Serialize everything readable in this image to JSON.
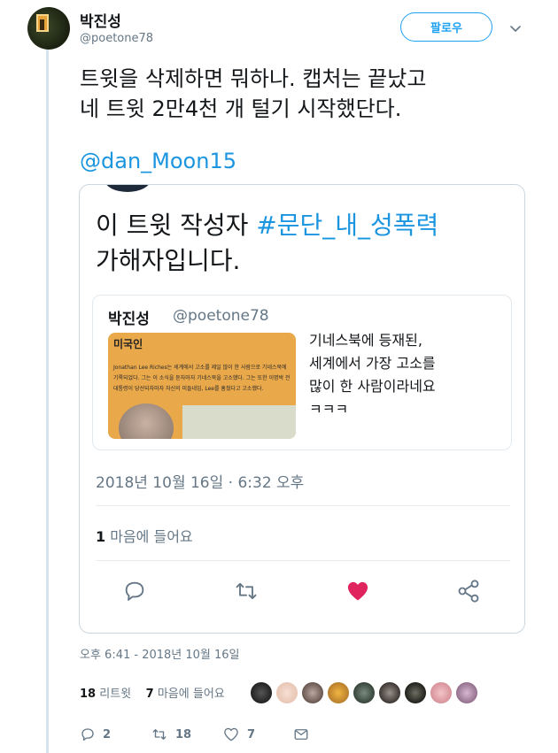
{
  "author": {
    "name": "박진성",
    "handle": "@poetone78"
  },
  "follow_button": "팔로우",
  "tweet": {
    "text_line1": "트윗을 삭제하면 뭐하나. 캡처는 끝났고",
    "text_line2": "네 트윗 2만4천 개 털기 시작했단다.",
    "mention": "@dan_Moon15"
  },
  "quoted_tweet": {
    "text_prefix": "이 트윗 작성자 ",
    "hashtag": "#문단_내_성폭력",
    "text_line2": "가해자입니다.",
    "timestamp": "2018년 10월 16일 · 6:32 오후",
    "likes_count": "1",
    "likes_label": "마음에 들어요",
    "inner": {
      "name": "박진성",
      "handle": "@poetone78",
      "thumb_title": "미국인",
      "thumb_body": "Jonathan Lee Riches는 세계에서 고소를 제일 많이 한 사람으로 기네스북에 기록되었다. 그는 이 소식을 듣자마자 기네스북을 고소했다. 그는 또한 이명박 전 대통령이 당선되자마자 자신의 미들네임, Lee를 훔쳤다고 고소했다.",
      "text_line1": "기네스북에 등재된,",
      "text_line2": "세계에서 가장 고소를",
      "text_line3": "많이 한 사람이라네요",
      "text_line4": "ㅋㅋㅋ"
    }
  },
  "tweet_time": "오후 6:41 - 2018년 10월 16일",
  "stats": {
    "retweets_count": "18",
    "retweets_label": "리트윗",
    "likes_count": "7",
    "likes_label": "마음에 들어요"
  },
  "bottom_actions": {
    "replies": "2",
    "retweets": "18",
    "likes": "7"
  },
  "colors": {
    "accent": "#1da1f2",
    "link": "#1b95e0",
    "heart": "#e0245e",
    "muted": "#657786"
  }
}
